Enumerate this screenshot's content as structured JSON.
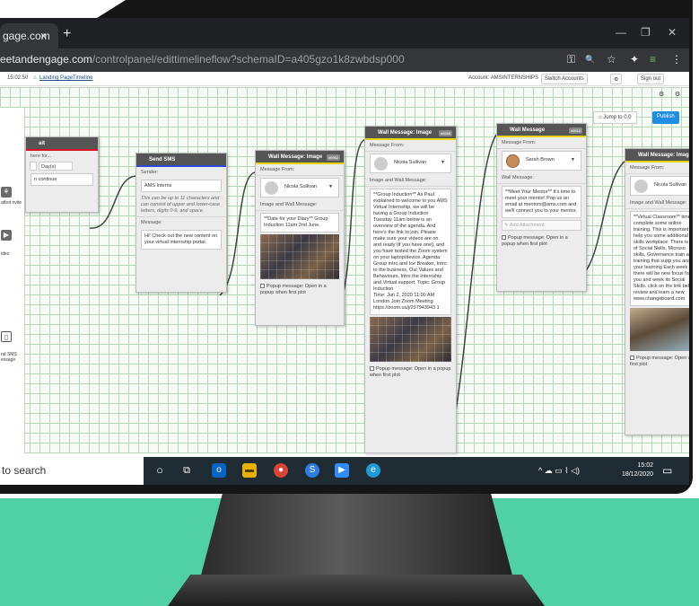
{
  "browser": {
    "tab_title": "gage.com",
    "tab_close": "×",
    "new_tab": "+",
    "url_host": "eetandengage.com",
    "url_path": "/controlpanel/edittimelineflow?schemaID=a405gzo1k8zwbdsp000",
    "minimize": "—",
    "restore": "❐",
    "close": "✕",
    "tools": [
      "⚿",
      "🔍",
      "☆",
      "✦",
      "≡",
      "⋮"
    ]
  },
  "appbar": {
    "time": "15:02:50",
    "breadcrumb_home_icon": "⌂",
    "breadcrumb_1": "Landing Page",
    "breadcrumb_2": "Timeline",
    "account": "Account: AMSINTERNSHIPS",
    "switch_accounts": "Switch Accounts",
    "gear": "⚙",
    "sign_out": "Sign out"
  },
  "canvas_controls": {
    "jump": "Jump to 0,0",
    "publish": "Publish"
  },
  "left_panel": {
    "items": [
      {
        "label": "atbot\nnvite"
      },
      {
        "label": "ideo"
      },
      {
        "label": "nd SMS\nessage"
      }
    ]
  },
  "node_wait": {
    "title": "ait",
    "wait_label": "here for...",
    "unit": "Day(s)",
    "action": "n continue"
  },
  "node_sms": {
    "title": "Send SMS",
    "sender_label": "Sender:",
    "sender": "AMS Interns",
    "hint": "This can be up to 11 characters and can consist of upper and lower-case letters, digits 0-9, and space.",
    "message_label": "Message:",
    "message": "Hi! Check out the new content on your virtual internship portal."
  },
  "node_w1": {
    "title": "Wall Message: Image",
    "tag": "#0062",
    "from_label": "Message From:",
    "from": "Nicola Sullivan",
    "section": "Image and Wall Message:",
    "text": "**Date for your Diary** Group Induction 11am 2nd June.",
    "popup": "Popup message: Open in a popup when first plot"
  },
  "node_w2": {
    "title": "Wall Message: Image",
    "tag": "#0030",
    "from_label": "Message From:",
    "from": "Nicola Sullivan",
    "section": "Image and Wall Message:",
    "text": "**Group Induction** As Paul explained to welcome to you AMS Virtual Internship, we will be having a Group Induction Tuesday 11am below is an overview of the agenda. And here's the link to join. Please make sure your videos are on and ready (if you have one), and you have tested the Zoom system on your laptop/device. Agenda: Group intro and Ice Breaker, Intro to the business, Our Values and Behaviours, Intro the Internship and Virtual support. Topic: Group Induction\nTime: Jun 2, 2020 11:00 AM London Join Zoom Meeting https://zoom.us/j/297943943 1",
    "popup": "Popup message: Open in a popup when first plot"
  },
  "node_w3": {
    "title": "Wall Message",
    "tag": "#0012",
    "from_label": "Message From:",
    "from": "Sarah Brown",
    "section": "Wall Message:",
    "text": "**Meet Your Mentor** It's time to meet your mentor! Pop us an email at mentors@ams.com and we'll connect you to your mentor.",
    "attach": "Add Attachment",
    "popup": "Popup message: Open in a popup when first plot"
  },
  "node_w4": {
    "title": "Wall Message: Image",
    "from_label": "Message From:",
    "from": "Nicola Sullivan",
    "section": "Image and Wall Message:",
    "text": "**Virtual Classroom** time to complete some online training. This is important to help you some additional skills workplace. There is a of Social Skills, Microso skills, Governance train and training that supp you and your learning Each week there will be new focus for you and week its Social Skills. click on the link below review and learn a new www.changeboard.com",
    "popup": "Popup message: Open when first plot"
  },
  "taskbar": {
    "search": "to search",
    "date_time": "15:02\n18/12/2020"
  }
}
